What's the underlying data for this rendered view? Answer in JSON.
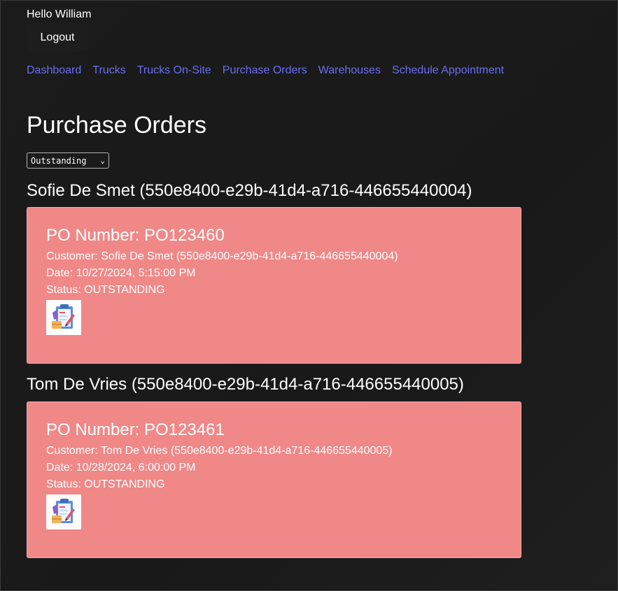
{
  "header": {
    "greeting": "Hello William",
    "logout_label": "Logout"
  },
  "nav": {
    "items": [
      {
        "label": "Dashboard"
      },
      {
        "label": "Trucks"
      },
      {
        "label": "Trucks On-Site"
      },
      {
        "label": "Purchase Orders"
      },
      {
        "label": "Warehouses"
      },
      {
        "label": "Schedule Appointment"
      }
    ],
    "link_color": "#6b6cf0"
  },
  "main": {
    "title": "Purchase Orders",
    "filter": {
      "selected": "Outstanding",
      "icon": "chevron-down-icon"
    },
    "card_color": "#f08888",
    "groups": [
      {
        "heading": "Sofie De Smet (550e8400-e29b-41d4-a716-446655440004)",
        "orders": [
          {
            "po_number": "PO Number: PO123460",
            "customer": "Customer: Sofie De Smet (550e8400-e29b-41d4-a716-446655440004)",
            "date": "Date: 10/27/2024, 5:15:00 PM",
            "status": "Status: OUTSTANDING",
            "icon": "clipboard-order-icon"
          }
        ]
      },
      {
        "heading": "Tom De Vries (550e8400-e29b-41d4-a716-446655440005)",
        "orders": [
          {
            "po_number": "PO Number: PO123461",
            "customer": "Customer: Tom De Vries (550e8400-e29b-41d4-a716-446655440005)",
            "date": "Date: 10/28/2024, 6:00:00 PM",
            "status": "Status: OUTSTANDING",
            "icon": "clipboard-order-icon"
          }
        ]
      }
    ]
  }
}
